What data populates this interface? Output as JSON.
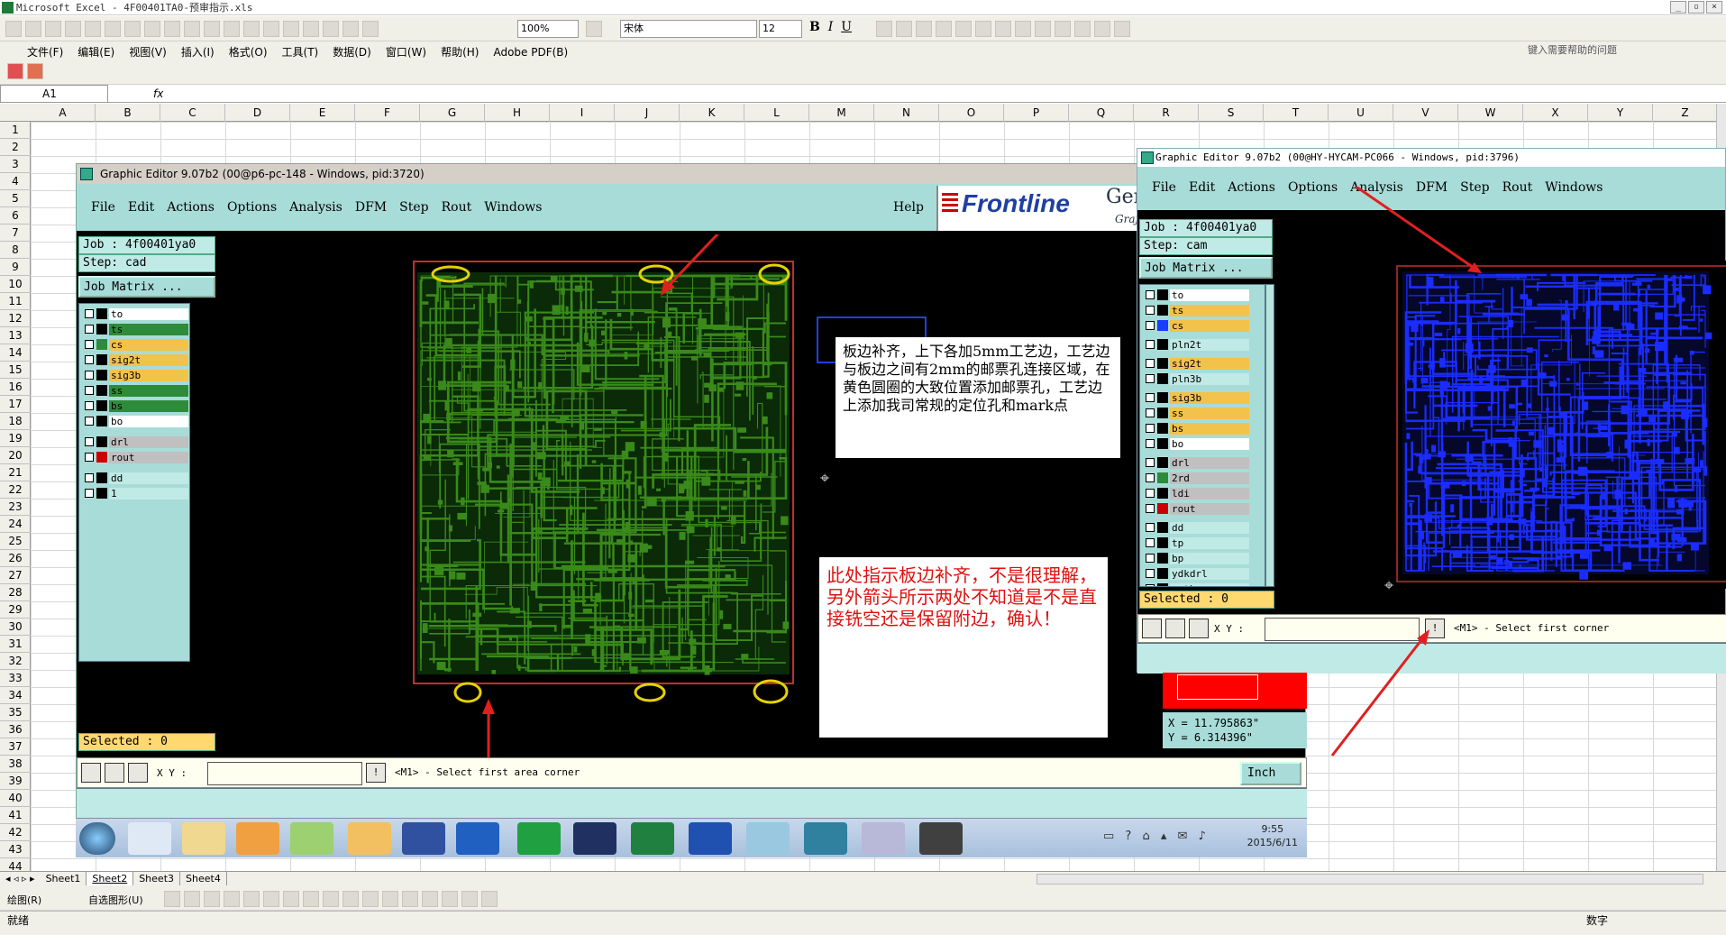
{
  "excel": {
    "title": "Microsoft Excel - 4F00401TA0-预审指示.xls",
    "font_name": "宋体",
    "font_size": "12",
    "zoom": "100%",
    "menu": [
      "文件(F)",
      "编辑(E)",
      "视图(V)",
      "插入(I)",
      "格式(O)",
      "工具(T)",
      "数据(D)",
      "窗口(W)",
      "帮助(H)",
      "Adobe PDF(B)"
    ],
    "help_placeholder": "键入需要帮助的问题",
    "name_box": "A1",
    "fx": "fx",
    "columns": [
      "A",
      "B",
      "C",
      "D",
      "E",
      "F",
      "G",
      "H",
      "I",
      "J",
      "K",
      "L",
      "M",
      "N",
      "O",
      "P",
      "Q",
      "R",
      "S",
      "T",
      "U",
      "V",
      "W",
      "X",
      "Y",
      "Z"
    ],
    "rows": [
      "1",
      "2",
      "3",
      "4",
      "5",
      "6",
      "7",
      "8",
      "9",
      "10",
      "11",
      "12",
      "13",
      "14",
      "15",
      "16",
      "17",
      "18",
      "19",
      "20",
      "21",
      "22",
      "23",
      "24",
      "25",
      "26",
      "27",
      "28",
      "29",
      "30",
      "31",
      "32",
      "33",
      "34",
      "35",
      "36",
      "37",
      "38",
      "39",
      "40",
      "41",
      "42",
      "43",
      "44"
    ],
    "sheets": [
      "Sheet1",
      "Sheet2",
      "Sheet3",
      "Sheet4"
    ],
    "draw_label": "绘图(R)",
    "autoshape_label": "自选图形(U)",
    "status": "就绪",
    "status_mode": "数字"
  },
  "ge1": {
    "title": "Graphic Editor 9.07b2 (00@p6-pc-148 - Windows, pid:3720)",
    "menu": [
      "File",
      "Edit",
      "Actions",
      "Options",
      "Analysis",
      "DFM",
      "Step",
      "Rout",
      "Windows"
    ],
    "help": "Help",
    "brand": "Frontline",
    "brand_extra": "Gene",
    "brand_sub": "Graj",
    "job": "Job : 4f00401ya0",
    "step": "Step: cad",
    "job_matrix": "Job Matrix ...",
    "layers": [
      {
        "name": "to",
        "color": "#ffffff",
        "dot": "#000000"
      },
      {
        "name": "ts",
        "color": "#2e8b3a",
        "dot": "#000000"
      },
      {
        "name": "cs",
        "color": "#f3c24a",
        "dot": "#2e8b3a"
      },
      {
        "name": "sig2t",
        "color": "#f3c24a",
        "dot": "#000000"
      },
      {
        "name": "sig3b",
        "color": "#f3c24a",
        "dot": "#000000"
      },
      {
        "name": "ss",
        "color": "#2e8b3a",
        "dot": "#000000"
      },
      {
        "name": "bs",
        "color": "#2e8b3a",
        "dot": "#000000"
      },
      {
        "name": "bo",
        "color": "#ffffff",
        "dot": "#000000"
      },
      {
        "name": "drl",
        "color": "#c0c0c0",
        "dot": "#000000"
      },
      {
        "name": "rout",
        "color": "#c0c0c0",
        "dot": "#cc0000"
      },
      {
        "name": "dd",
        "color": "#c0eae6",
        "dot": "#000000"
      },
      {
        "name": "1",
        "color": "#c0eae6",
        "dot": "#000000"
      }
    ],
    "selected": "Selected : 0",
    "xy_label": "X Y :",
    "cmd": "<M1> - Select first area corner",
    "units": "Inch",
    "note1": "板边补齐，上下各加5mm工艺边，工艺边与板边之间有2mm的邮票孔连接区域，在黄色圆圈的大致位置添加邮票孔，工艺边上添加我司常规的定位孔和mark点",
    "note2": "此处指示板边补齐，不是很理解，另外箭头所示两处不知道是不是直接铣空还是保留附边，确认！"
  },
  "ge2": {
    "title": "Graphic Editor 9.07b2 (00@HY-HYCAM-PC066 - Windows, pid:3796)",
    "menu": [
      "File",
      "Edit",
      "Actions",
      "Options",
      "Analysis",
      "DFM",
      "Step",
      "Rout",
      "Windows"
    ],
    "job": "Job : 4f00401ya0",
    "step": "Step: cam",
    "job_matrix": "Job Matrix ...",
    "layers": [
      {
        "name": "to",
        "color": "#ffffff",
        "dot": "#000000"
      },
      {
        "name": "ts",
        "color": "#f3c24a",
        "dot": "#000000"
      },
      {
        "name": "cs",
        "color": "#f3c24a",
        "dot": "#1a3cff"
      },
      {
        "name": "pln2t",
        "color": "#c0eae6",
        "dot": "#000000"
      },
      {
        "name": "sig2t",
        "color": "#f3c24a",
        "dot": "#000000"
      },
      {
        "name": "pln3b",
        "color": "#c0eae6",
        "dot": "#000000"
      },
      {
        "name": "sig3b",
        "color": "#f3c24a",
        "dot": "#000000"
      },
      {
        "name": "ss",
        "color": "#f3c24a",
        "dot": "#000000"
      },
      {
        "name": "bs",
        "color": "#f3c24a",
        "dot": "#000000"
      },
      {
        "name": "bo",
        "color": "#ffffff",
        "dot": "#000000"
      },
      {
        "name": "drl",
        "color": "#c0c0c0",
        "dot": "#000000"
      },
      {
        "name": "2rd",
        "color": "#c0c0c0",
        "dot": "#2e8b3a"
      },
      {
        "name": "ldi",
        "color": "#c0c0c0",
        "dot": "#000000"
      },
      {
        "name": "rout",
        "color": "#c0c0c0",
        "dot": "#cc0000"
      },
      {
        "name": "dd",
        "color": "#c0eae6",
        "dot": "#000000"
      },
      {
        "name": "tp",
        "color": "#c0eae6",
        "dot": "#000000"
      },
      {
        "name": "bp",
        "color": "#c0eae6",
        "dot": "#000000"
      },
      {
        "name": "ydkdrl",
        "color": "#c0eae6",
        "dot": "#000000"
      },
      {
        "name": "mnth",
        "color": "#c0eae6",
        "dot": "#000000"
      }
    ],
    "selected": "Selected : 0",
    "xy_label": "X Y :",
    "cmd": "<M1> - Select first corner",
    "coord_x": "X = 11.795863\"",
    "coord_y": "Y = 6.314396\""
  },
  "taskbar": {
    "time": "9:55",
    "date": "2015/6/11"
  },
  "colors": {
    "pcb_green": "#3a8a1a",
    "pcb_blue": "#1a2cff",
    "arrow": "#e02020",
    "note_red": "#e01010",
    "teal": "#a8dcd8"
  }
}
